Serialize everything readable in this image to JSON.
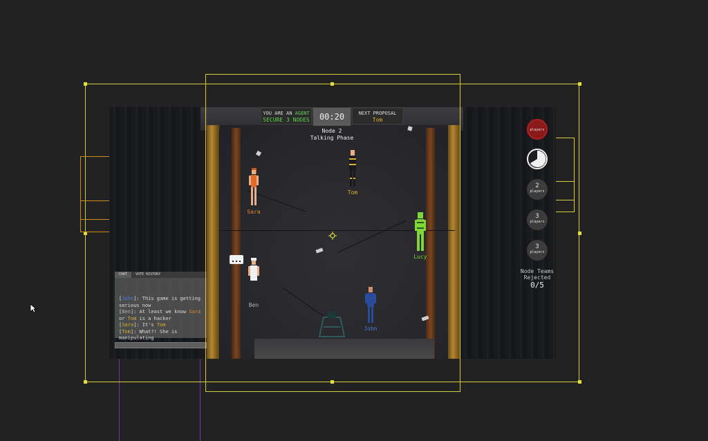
{
  "hud": {
    "role_prefix": "YOU ARE AN",
    "role": "AGENT",
    "objective": "SECURE 3 NODES",
    "timer": "00:20",
    "next_proposal_label": "NEXT PROPOSAL",
    "next_proposal_player": "Tom",
    "node": "Node 2",
    "phase": "Talking Phase"
  },
  "characters": [
    {
      "name": "Sara",
      "color": "#e08a2a"
    },
    {
      "name": "Tom",
      "color": "#e0b030"
    },
    {
      "name": "Lucy",
      "color": "#7ed63a"
    },
    {
      "name": "Ben",
      "color": "#b0b0b0"
    },
    {
      "name": "John",
      "color": "#4a7ae0"
    }
  ],
  "nodes": [
    {
      "count": "",
      "label": "players",
      "state": "failed"
    },
    {
      "count": "",
      "label": "",
      "state": "current"
    },
    {
      "count": "2",
      "label": "players",
      "state": "pending"
    },
    {
      "count": "3",
      "label": "players",
      "state": "pending"
    },
    {
      "count": "3",
      "label": "players",
      "state": "pending"
    }
  ],
  "rejected": {
    "line1": "Node Teams",
    "line2": "Rejected",
    "value": "0/5"
  },
  "chat": {
    "tabs": [
      "CHAT",
      "VOTE HISTORY"
    ],
    "messages": [
      {
        "speaker": "John",
        "speaker_color": "#4a7ae0",
        "text": "This game is getting serious now"
      },
      {
        "speaker": "Ben",
        "speaker_color": "#b0b0b0",
        "text_parts": [
          "At least we know ",
          "Sara",
          " or ",
          "Tom",
          " is a hacker"
        ]
      },
      {
        "speaker": "Sara",
        "speaker_color": "#e0b030",
        "text_parts": [
          "It's ",
          "Tom"
        ]
      },
      {
        "speaker": "Tom",
        "speaker_color": "#e0b030",
        "text": "What?! She is manipulating"
      }
    ],
    "input_value": ""
  },
  "colors": {
    "agent_green": "#5fd34a",
    "editor_selection": "#d7cf3a",
    "editor_orange": "#d08a1c"
  }
}
